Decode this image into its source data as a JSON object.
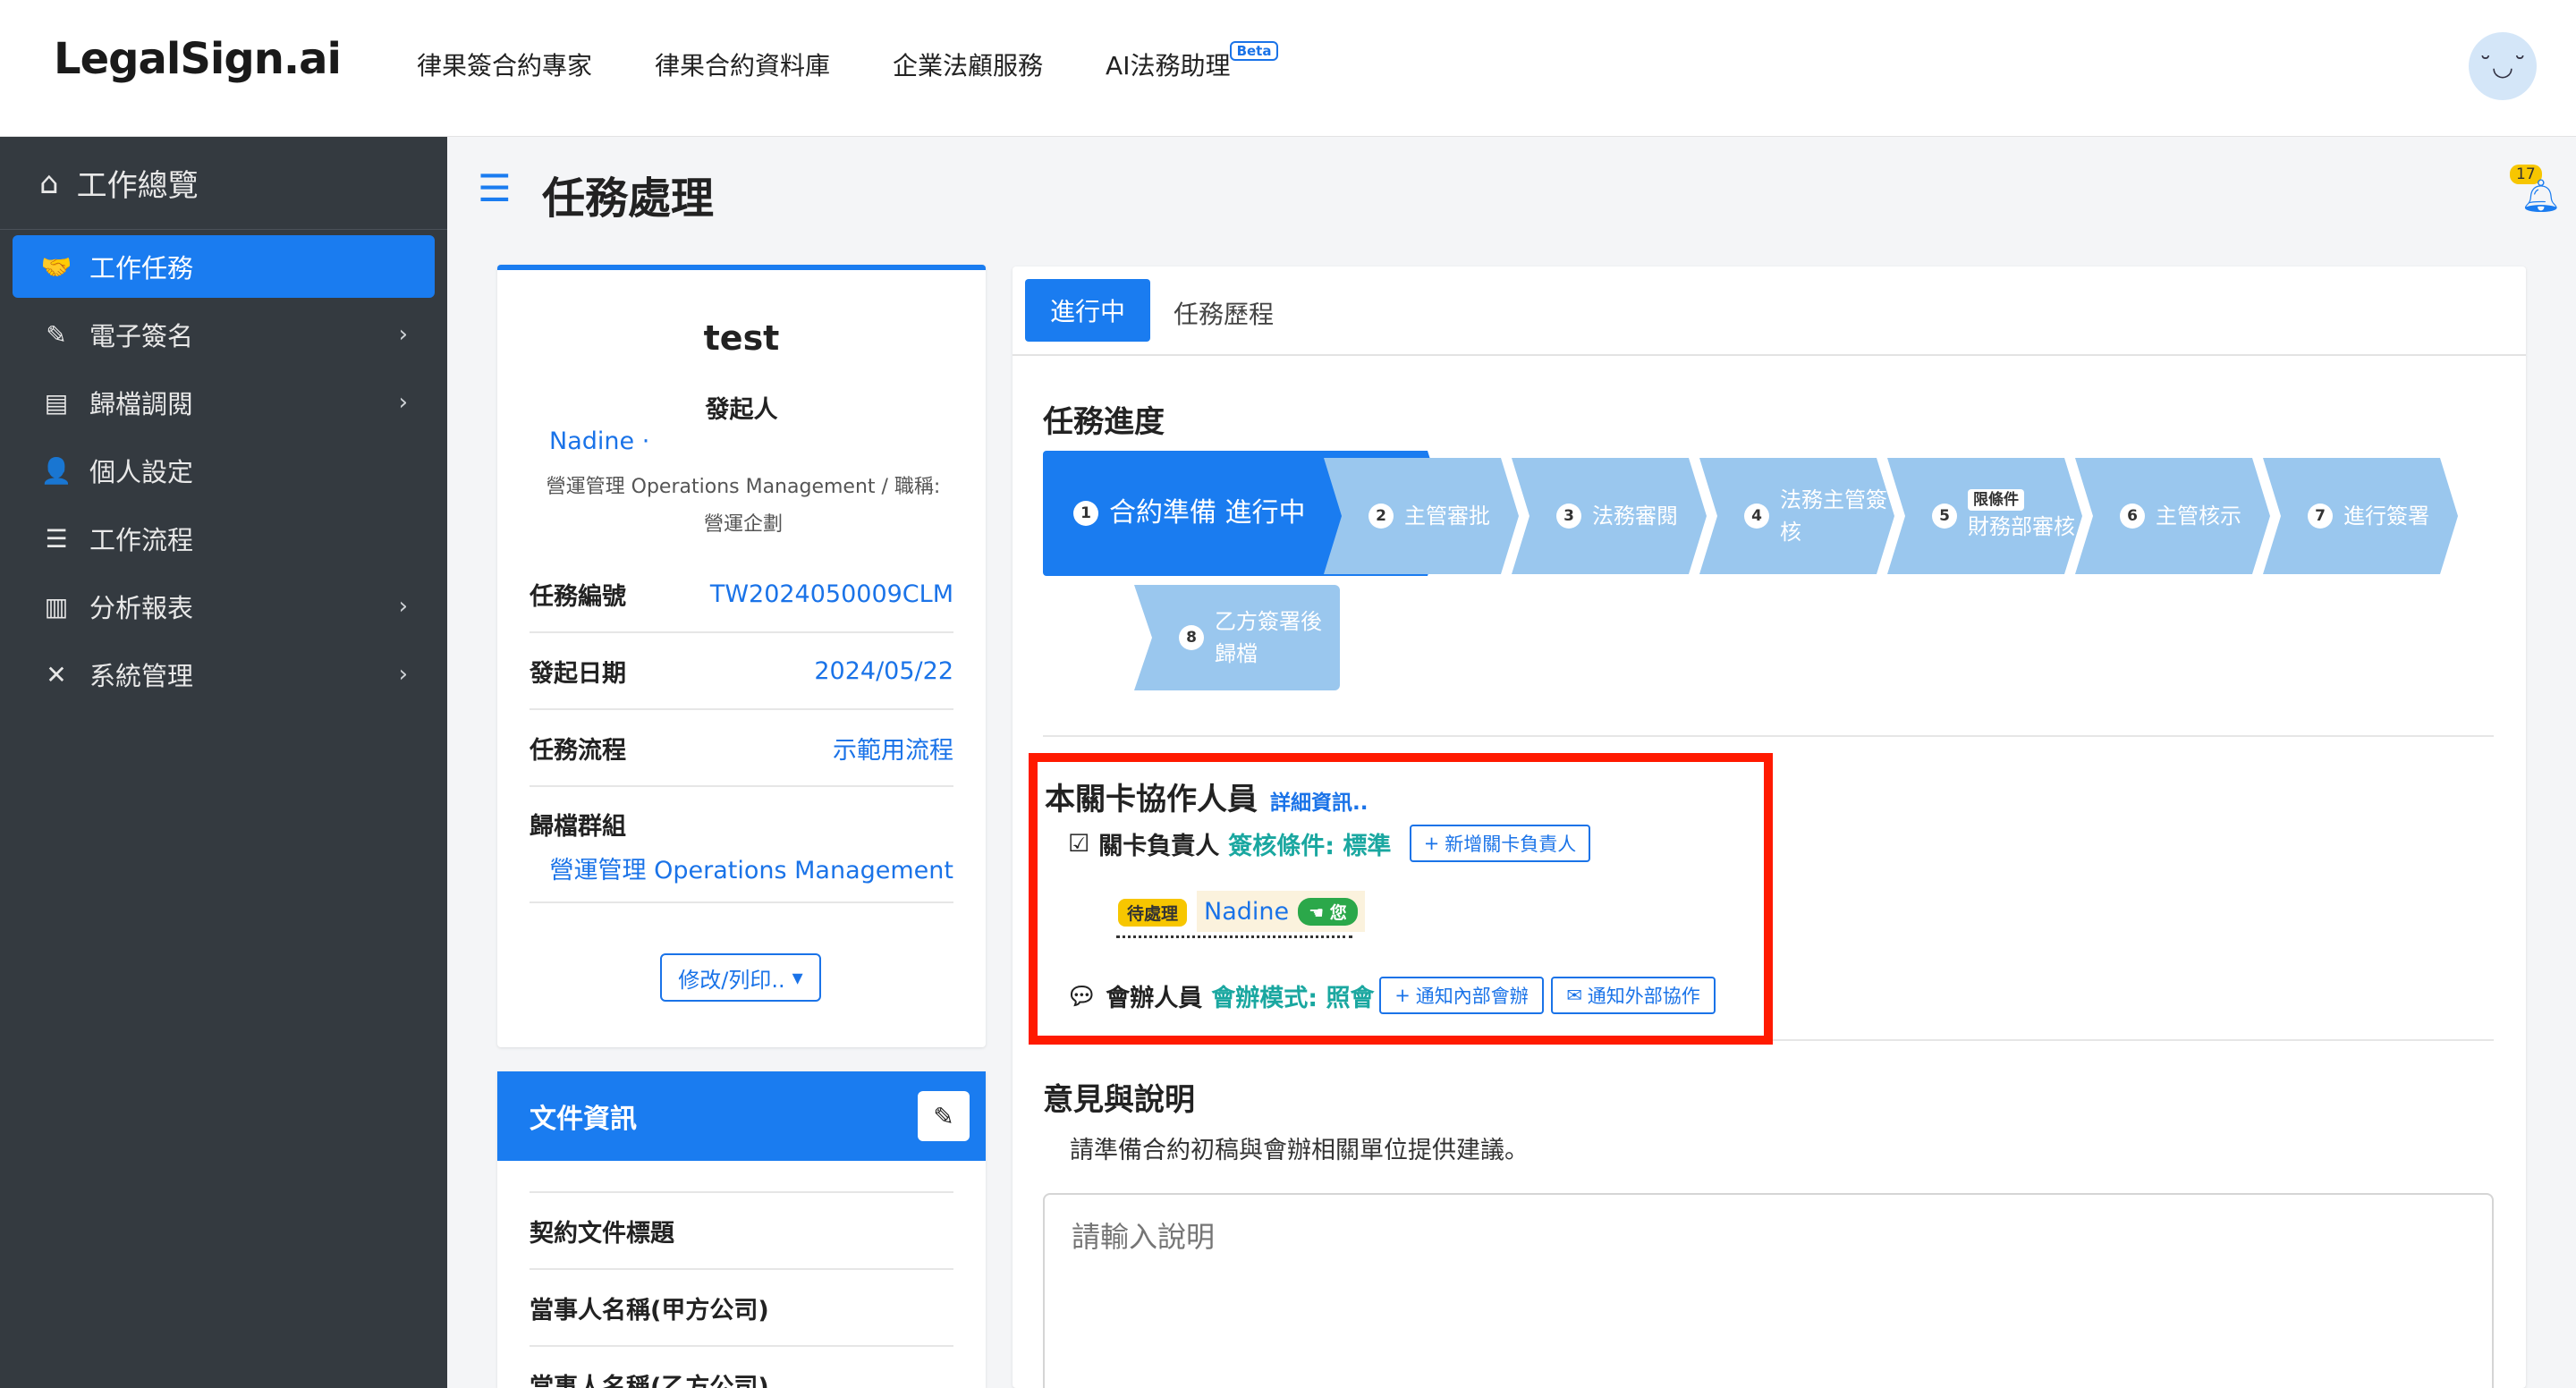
{
  "app": {
    "logo": "LegalSign.ai",
    "nav": [
      "律果簽合約專家",
      "律果合約資料庫",
      "企業法顧服務",
      "AI法務助理"
    ],
    "beta": "Beta",
    "avatar_face": "˘◡˘"
  },
  "sidebar": {
    "header": "工作總覽",
    "items": [
      {
        "label": "工作任務",
        "icon": "handshake-icon",
        "active": true
      },
      {
        "label": "電子簽名",
        "icon": "signature-icon",
        "chevron": true
      },
      {
        "label": "歸檔調閱",
        "icon": "archive-icon",
        "chevron": true
      },
      {
        "label": "個人設定",
        "icon": "user-gear-icon"
      },
      {
        "label": "工作流程",
        "icon": "list-check-icon"
      },
      {
        "label": "分析報表",
        "icon": "bar-chart-icon",
        "chevron": true
      },
      {
        "label": "系統管理",
        "icon": "tools-icon",
        "chevron": true
      }
    ]
  },
  "header": {
    "title": "任務處理",
    "bell_count": "17"
  },
  "task": {
    "name": "test",
    "initiator_label": "發起人",
    "initiator_name": "Nadine ·",
    "initiator_dept_line1": "營運管理 Operations Management / 職稱:",
    "initiator_dept_line2": "營運企劃",
    "rows": [
      {
        "k": "任務編號",
        "v": "TW2024050009CLM"
      },
      {
        "k": "發起日期",
        "v": "2024/05/22"
      },
      {
        "k": "任務流程",
        "v": "示範用流程"
      }
    ],
    "group_label": "歸檔群組",
    "group_value": "營運管理 Operations Management",
    "modify_label": "修改/列印..",
    "modify_caret": "▾"
  },
  "document": {
    "title": "文件資訊",
    "rows": [
      "契約文件標題",
      "當事人名稱(甲方公司)",
      "當事人名稱(乙方公司)"
    ]
  },
  "tabs": {
    "active": "進行中",
    "other": "任務歷程"
  },
  "progress": {
    "title": "任務進度",
    "steps": [
      {
        "num": "1",
        "label": "合約準備 進行中"
      },
      {
        "num": "2",
        "label": "主管審批"
      },
      {
        "num": "3",
        "label": "法務審閱"
      },
      {
        "num": "4",
        "label": "法務主管簽核"
      },
      {
        "num": "5",
        "cond": "限條件",
        "label": "財務部審核"
      },
      {
        "num": "6",
        "label": "主管核示"
      },
      {
        "num": "7",
        "label": "進行簽署"
      },
      {
        "num": "8",
        "label": "乙方簽署後歸檔"
      }
    ]
  },
  "collab": {
    "title": "本關卡協作人員",
    "detail_link": "詳細資訊..",
    "owner_label": "關卡負責人",
    "owner_mode": "簽核條件: 標準",
    "add_owner": "新增關卡負責人",
    "pending": "待處理",
    "owner_name": "Nadine",
    "you": "您",
    "cosign_label": "會辦人員",
    "cosign_mode": "會辦模式: 照會",
    "notify_internal": "通知內部會辦",
    "notify_external": "通知外部協作"
  },
  "notes": {
    "title": "意見與說明",
    "text": "請準備合約初稿與會辦相關單位提供建議。",
    "placeholder": "請輸入說明"
  },
  "colors": {
    "primary": "#1a7cf0",
    "step_inactive": "#9ac7ee",
    "sidebar": "#343a40",
    "highlight": "#ff1a00",
    "pending": "#f7c600",
    "you": "#2ba84a"
  }
}
